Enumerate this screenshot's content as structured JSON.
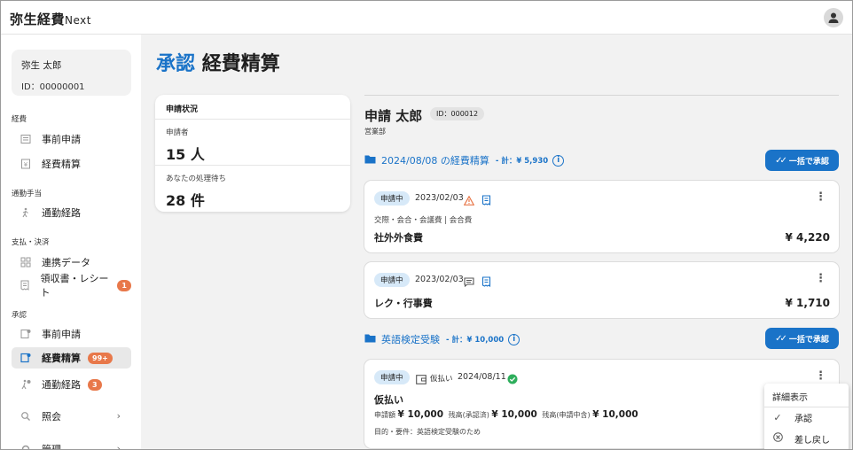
{
  "app": {
    "logo_main": "弥生経費",
    "logo_sub": "Next"
  },
  "user": {
    "name": "弥生 太郎",
    "id": "ID：00000001"
  },
  "sidebar": {
    "sections": {
      "expense": "経費",
      "commute": "通勤手当",
      "payment": "支払・決済",
      "approval": "承認"
    },
    "items": {
      "pre_application": "事前申請",
      "expense_settlement": "経費精算",
      "commute_route": "通勤経路",
      "linked_data": "連携データ",
      "receipts": "領収書・レシート",
      "receipts_badge": "1",
      "approval_pre_application": "事前申請",
      "approval_expense": "経費精算",
      "approval_expense_badge": "99+",
      "approval_commute": "通勤経路",
      "approval_commute_badge": "3",
      "inquiry": "照会",
      "manage": "管理"
    }
  },
  "page": {
    "title_accent": "承認",
    "title_main": "経費精算"
  },
  "status_card": {
    "title": "申請状況",
    "applicants_label": "申請者",
    "applicants_value": "15 人",
    "pending_label": "あなたの処理待ち",
    "pending_value": "28 件"
  },
  "applicant": {
    "name": "申請 太郎",
    "id": "ID：000012",
    "dept": "営業部"
  },
  "groups": [
    {
      "title": "2024/08/08 の経費精算",
      "sum": "- 計：¥ 5,930",
      "button": "一括で承認"
    },
    {
      "title": "英語検定受験",
      "sum": "- 計：¥ 10,000",
      "button": "一括で承認"
    }
  ],
  "cards": [
    {
      "status": "申請中",
      "date": "2023/02/03",
      "category": "交際・会合・会議費 | 会合費",
      "name": "社外外食費",
      "amount": "¥ 4,220"
    },
    {
      "status": "申請中",
      "date": "2023/02/03",
      "name": "レク・行事費",
      "amount": "¥ 1,710"
    },
    {
      "status": "申請中",
      "tag": "仮払い",
      "date": "2024/08/11",
      "name": "仮払い",
      "req_label": "申請額",
      "req_amount": "¥ 10,000",
      "bal_label": "残高(承認済)",
      "bal_amount": "¥ 10,000",
      "bal2_label": "残高(申請中含)",
      "bal2_amount": "¥ 10,000",
      "purpose": "目的・要件：英語検定受験のため"
    }
  ],
  "context_menu": {
    "header": "詳細表示",
    "approve": "承認",
    "send_back": "差し戻し"
  },
  "colors": {
    "accent": "#1a73c8",
    "badge": "#e8784a",
    "success": "#2eae5c",
    "warning": "#e8784a"
  }
}
